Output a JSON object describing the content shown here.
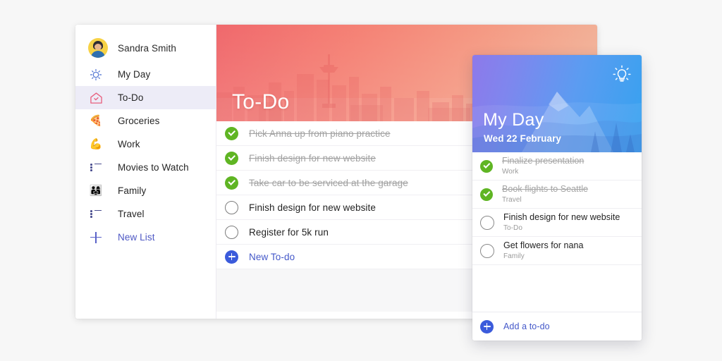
{
  "theme": {
    "page_background": "#f7f7f7",
    "accent_blue": "#4458c9",
    "complete_green": "#5fb523",
    "todo_banner_from": "#ef5f63",
    "todo_banner_to": "#f0b195",
    "myday_banner_from": "#8d79ea",
    "myday_banner_to": "#35a2f0",
    "selected_row": "#edecf7"
  },
  "sidebar": {
    "profile": {
      "name": "Sandra Smith",
      "avatar_icon": "user-avatar"
    },
    "items": [
      {
        "label": "My Day",
        "icon": "sun-icon",
        "icon_kind": "sun",
        "selected": false
      },
      {
        "label": "To-Do",
        "icon": "house-check-icon",
        "icon_kind": "house",
        "selected": true
      },
      {
        "label": "Groceries",
        "icon": "pizza-icon",
        "icon_kind": "emoji",
        "glyph": "🍕",
        "selected": false
      },
      {
        "label": "Work",
        "icon": "flexed-biceps-icon",
        "icon_kind": "emoji",
        "glyph": "💪",
        "selected": false
      },
      {
        "label": "Movies to Watch",
        "icon": "list-icon",
        "icon_kind": "list",
        "selected": false
      },
      {
        "label": "Family",
        "icon": "family-icon",
        "icon_kind": "emoji",
        "glyph": "👨‍👩‍👧",
        "selected": false
      },
      {
        "label": "Travel",
        "icon": "list-icon",
        "icon_kind": "list",
        "selected": false
      }
    ],
    "new_list": {
      "label": "New List",
      "icon": "plus-icon"
    }
  },
  "main": {
    "banner": {
      "title": "To-Do",
      "scene": "seattle-skyline-space-needle-mount-rainier"
    },
    "tasks": [
      {
        "text": "Pick Anna up from piano practice",
        "completed": true
      },
      {
        "text": "Finish design for new website",
        "completed": true
      },
      {
        "text": "Take car to be serviced at the garage",
        "completed": true
      },
      {
        "text": "Finish design for new website",
        "completed": false
      },
      {
        "text": "Register for 5k run",
        "completed": false
      }
    ],
    "new_todo": {
      "label": "New To-do",
      "icon": "plus-circle-icon"
    }
  },
  "myday": {
    "banner": {
      "title": "My Day",
      "date": "Wed 22 February",
      "bulb_icon": "lightbulb-icon",
      "scene": "mountain-landscape-pine-trees"
    },
    "tasks": [
      {
        "title": "Finalize presentation",
        "list": "Work",
        "completed": true
      },
      {
        "title": "Book flights to Seattle",
        "list": "Travel",
        "completed": true
      },
      {
        "title": "Finish design for new website",
        "list": "To-Do",
        "completed": false
      },
      {
        "title": "Get flowers for nana",
        "list": "Family",
        "completed": false
      }
    ],
    "footer": {
      "label": "Add a to-do",
      "icon": "plus-circle-icon"
    }
  }
}
